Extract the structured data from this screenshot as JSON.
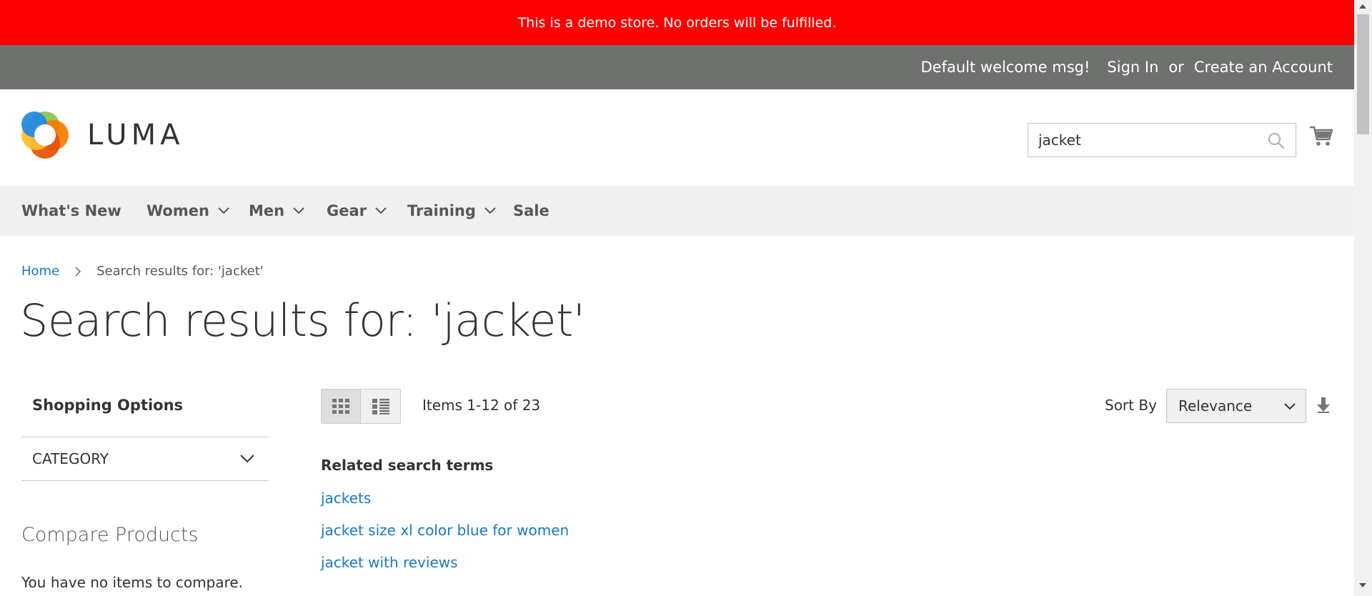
{
  "demo_notice": "This is a demo store. No orders will be fulfilled.",
  "panel": {
    "welcome": "Default welcome msg!",
    "sign_in": "Sign In",
    "or": "or",
    "create_account": "Create an Account"
  },
  "logo": {
    "text": "LUMA"
  },
  "search": {
    "value": "jacket",
    "icon": "search-icon"
  },
  "cart": {
    "icon": "cart-icon"
  },
  "nav": {
    "items": [
      {
        "label": "What's New",
        "has_submenu": false
      },
      {
        "label": "Women",
        "has_submenu": true
      },
      {
        "label": "Men",
        "has_submenu": true
      },
      {
        "label": "Gear",
        "has_submenu": true
      },
      {
        "label": "Training",
        "has_submenu": true
      },
      {
        "label": "Sale",
        "has_submenu": false
      }
    ]
  },
  "breadcrumb": {
    "home": "Home",
    "current": "Search results for: 'jacket'"
  },
  "page_title": "Search results for: 'jacket'",
  "sidebar": {
    "title": "Shopping Options",
    "filter_title": "CATEGORY",
    "compare_title": "Compare Products",
    "compare_empty": "You have no items to compare."
  },
  "toolbar": {
    "modes": [
      "grid",
      "list"
    ],
    "active_mode": "grid",
    "amount": "Items 1-12 of 23",
    "sort_label": "Sort By",
    "sort_value": "Relevance"
  },
  "related": {
    "title": "Related search terms",
    "terms": [
      "jackets",
      "jacket size xl color blue for women",
      "jacket with reviews"
    ]
  },
  "colors": {
    "demo_bar": "#ff0000",
    "panel_header": "#6e716e",
    "nav_bg": "#f0f0f0",
    "link": "#1979c3"
  }
}
